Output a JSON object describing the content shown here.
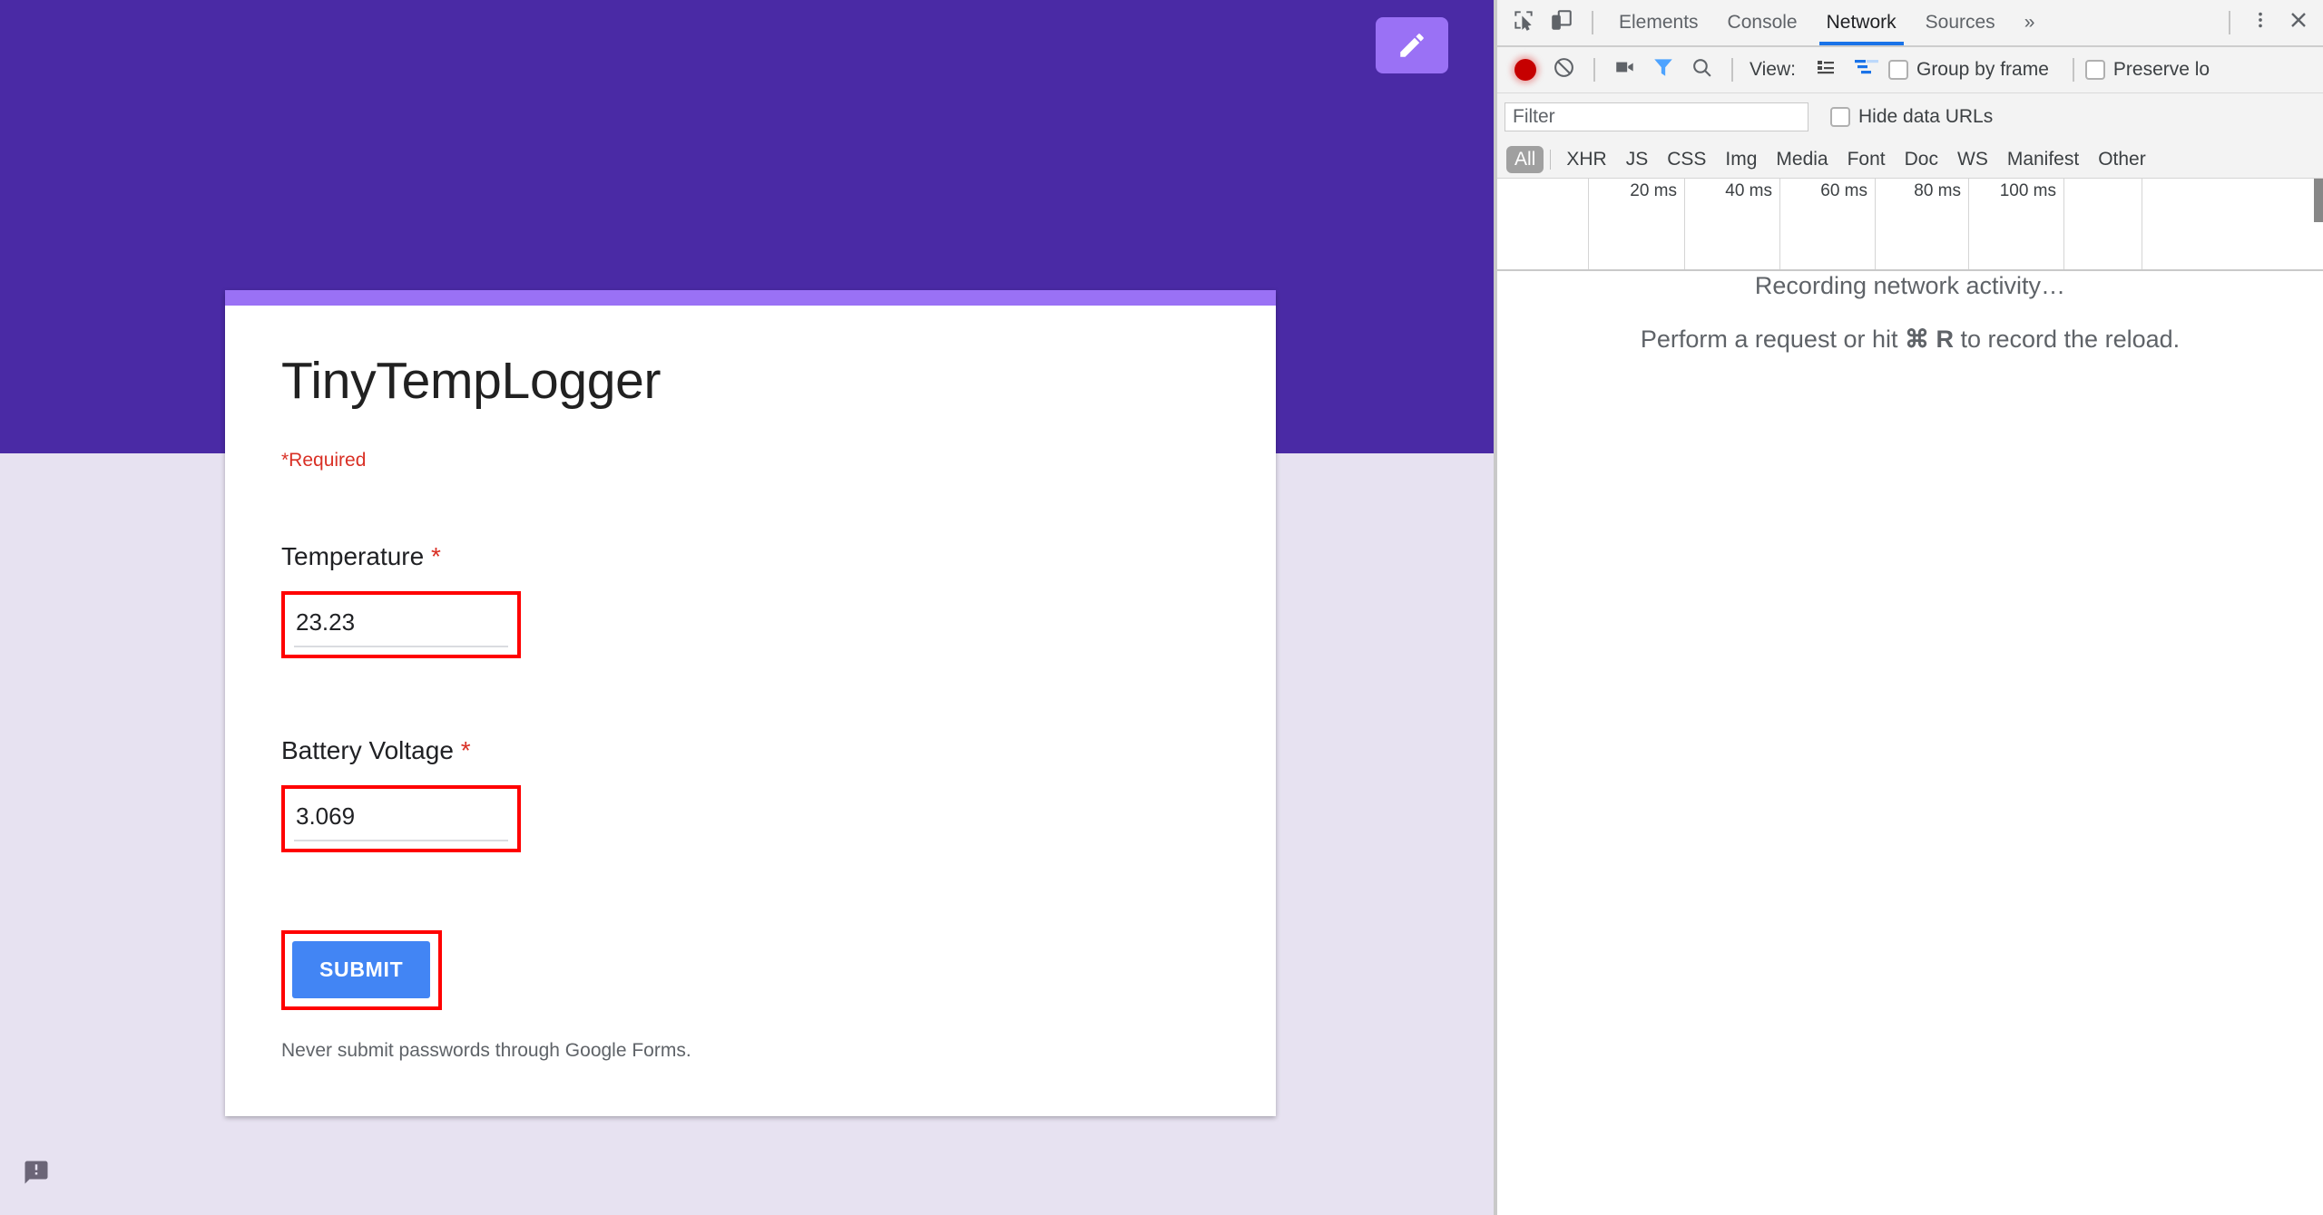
{
  "page": {
    "header": {
      "edit_icon": "pencil-icon"
    },
    "form": {
      "title": "TinyTempLogger",
      "required_note": "*Required",
      "required_marker": "*",
      "fields": [
        {
          "label": "Temperature",
          "value": "23.23",
          "required": true
        },
        {
          "label": "Battery Voltage",
          "value": "3.069",
          "required": true
        }
      ],
      "submit_label": "SUBMIT",
      "footer_note": "Never submit passwords through Google Forms."
    },
    "feedback_icon": "report-feedback-icon",
    "colors": {
      "header_purple": "#4a2aa5",
      "accent_purple": "#9a71f5",
      "page_background": "#e7e2f1",
      "required_red": "#d93025",
      "submit_blue": "#4285f4",
      "highlight_red": "#ff0000"
    }
  },
  "devtools": {
    "tabs": [
      {
        "label": "Elements",
        "active": false
      },
      {
        "label": "Console",
        "active": false
      },
      {
        "label": "Network",
        "active": true
      },
      {
        "label": "Sources",
        "active": false
      }
    ],
    "more_tabs_label": "»",
    "icons": {
      "inspect": "inspect-element-icon",
      "device": "device-toolbar-icon",
      "menu": "kebab-menu-icon",
      "close": "close-icon",
      "record": "record-icon",
      "clear": "clear-icon",
      "screenshot": "camera-icon",
      "filter": "filter-funnel-icon",
      "search": "search-icon",
      "list_view": "list-view-icon",
      "waterfall_view": "waterfall-view-icon"
    },
    "toolbar": {
      "view_label": "View:",
      "group_by_frame_label": "Group by frame",
      "group_by_frame_checked": false,
      "preserve_log_label": "Preserve lo",
      "preserve_log_checked": false
    },
    "filter": {
      "placeholder": "Filter",
      "value": "",
      "hide_data_urls_label": "Hide data URLs",
      "hide_data_urls_checked": false
    },
    "resource_types": [
      {
        "label": "All",
        "selected": true
      },
      {
        "label": "XHR",
        "selected": false
      },
      {
        "label": "JS",
        "selected": false
      },
      {
        "label": "CSS",
        "selected": false
      },
      {
        "label": "Img",
        "selected": false
      },
      {
        "label": "Media",
        "selected": false
      },
      {
        "label": "Font",
        "selected": false
      },
      {
        "label": "Doc",
        "selected": false
      },
      {
        "label": "WS",
        "selected": false
      },
      {
        "label": "Manifest",
        "selected": false
      },
      {
        "label": "Other",
        "selected": false
      }
    ],
    "timeline": {
      "ticks": [
        "20 ms",
        "40 ms",
        "60 ms",
        "80 ms",
        "100 ms"
      ]
    },
    "empty_state": {
      "line1": "Recording network activity…",
      "line2_pre": "Perform a request or hit ",
      "line2_key": "⌘ R",
      "line2_post": " to record the reload."
    },
    "accent_blue": "#1a73e8"
  }
}
